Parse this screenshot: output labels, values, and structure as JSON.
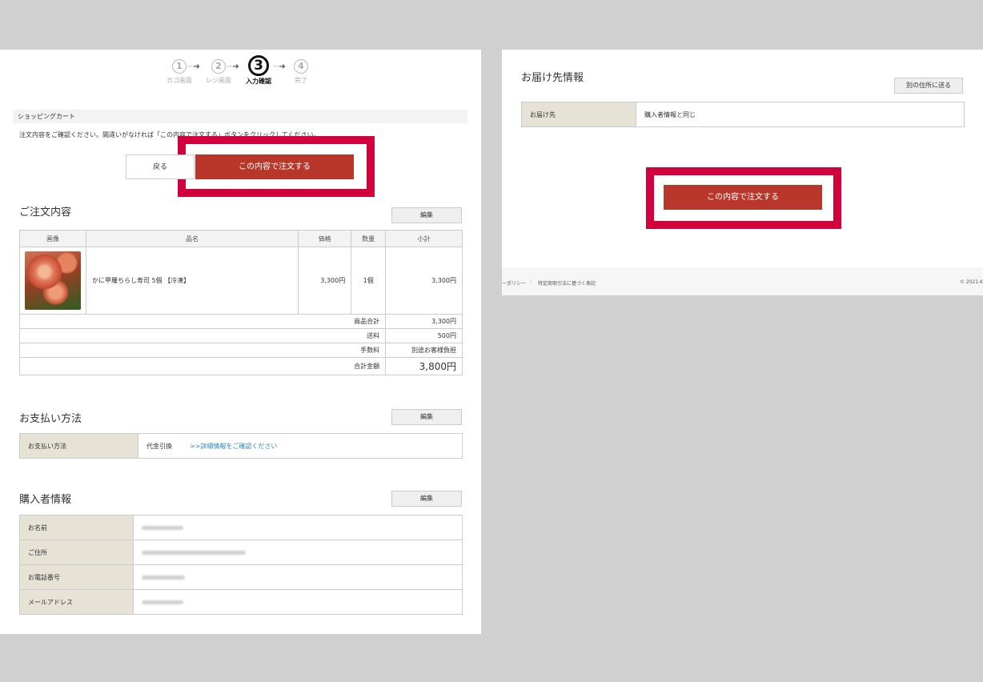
{
  "steps": [
    {
      "num": "1",
      "label": "カゴ画面"
    },
    {
      "num": "2",
      "label": "レジ画面"
    },
    {
      "num": "3",
      "label": "入力確認"
    },
    {
      "num": "4",
      "label": "完了"
    }
  ],
  "cart_bar": "ショッピングカート",
  "notice": "注文内容をご確認ください。間違いがなければ「この内容で注文する」ボタンをクリックしてください。",
  "back_label": "戻る",
  "order_button_label": "この内容で注文する",
  "edit_label": "編集",
  "order_section": {
    "title": "ご注文内容",
    "headers": [
      "画像",
      "品名",
      "価格",
      "数量",
      "小計"
    ],
    "item": {
      "name": "かに甲羅ちらし寿司 5個 【冷凍】",
      "price": "3,300円",
      "qty": "1個",
      "subtotal": "3,300円"
    },
    "summary": [
      {
        "label": "商品合計",
        "value": "3,300円"
      },
      {
        "label": "送料",
        "value": "500円"
      },
      {
        "label": "手数料",
        "value": "別途お客様負担"
      },
      {
        "label": "合計金額",
        "value": "3,800円"
      }
    ]
  },
  "payment_section": {
    "title": "お支払い方法",
    "label": "お支払い方法",
    "value": "代金引換",
    "link": ">>詳細情報をご確認ください"
  },
  "buyer_section": {
    "title": "購入者情報",
    "rows": [
      {
        "label": "お名前"
      },
      {
        "label": "ご住所"
      },
      {
        "label": "お電話番号"
      },
      {
        "label": "メールアドレス"
      }
    ]
  },
  "delivery_section": {
    "title": "お届け先情報",
    "other_address_label": "別の住所に送る",
    "label": "お届け先",
    "value": "購入者情報と同じ"
  },
  "footer": {
    "policy": "ーポリシー",
    "tokusho": "特定商取引法に基づく表記",
    "copyright": "© 2021.K"
  }
}
